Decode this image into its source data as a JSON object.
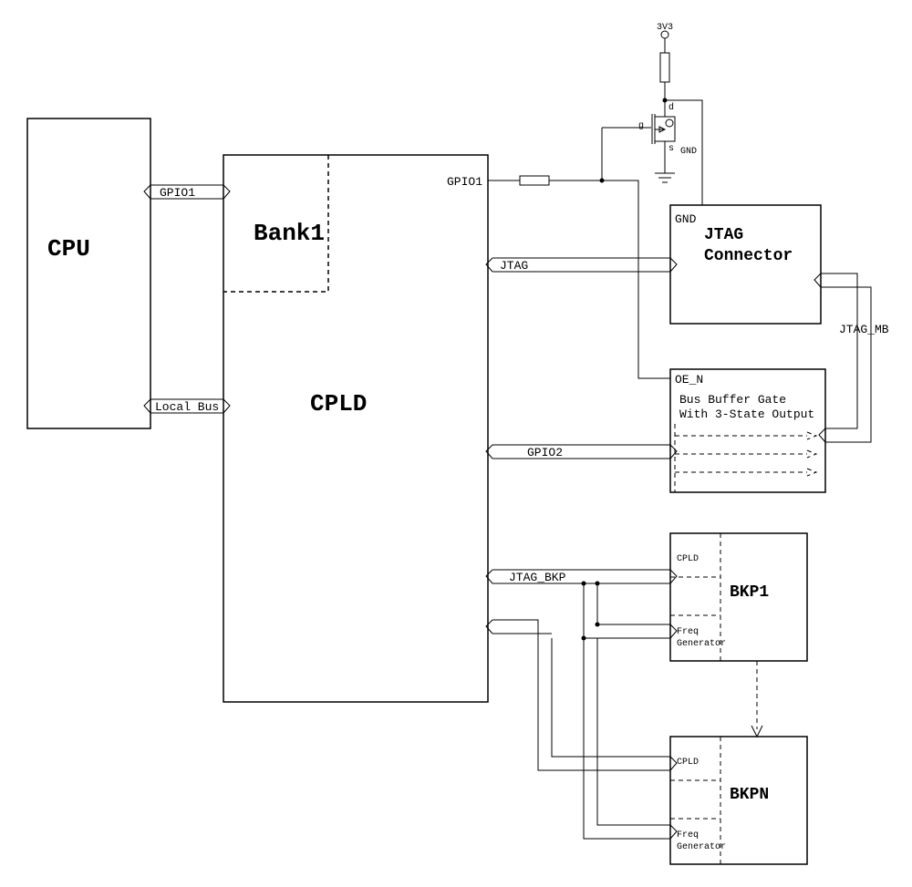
{
  "power": {
    "v33": "3V3",
    "gnd": "GND"
  },
  "blocks": {
    "cpu": "CPU",
    "cpld": "CPLD",
    "bank1": "Bank1",
    "jtag_conn": {
      "l1": "JTAG",
      "l2": "Connector"
    },
    "buffer": {
      "l0": "OE_N",
      "l1": "Bus Buffer Gate",
      "l2": "With 3-State Output"
    },
    "bkp1": {
      "name": "BKP1",
      "cpld": "CPLD",
      "fg1": "Freq",
      "fg2": "Generator"
    },
    "bkpn": {
      "name": "BKPN",
      "cpld": "CPLD",
      "fg1": "Freq",
      "fg2": "Generator"
    }
  },
  "signals": {
    "gpio1_left": "GPIO1",
    "gpio1_right": "GPIO1",
    "local_bus": "Local Bus",
    "jtag": "JTAG",
    "jtag_mb": "JTAG_MB",
    "gpio2": "GPIO2",
    "jtag_bkp": "JTAG_BKP",
    "gnd_label": "GND"
  },
  "mosfet": {
    "g": "g",
    "d": "d",
    "s": "s"
  }
}
